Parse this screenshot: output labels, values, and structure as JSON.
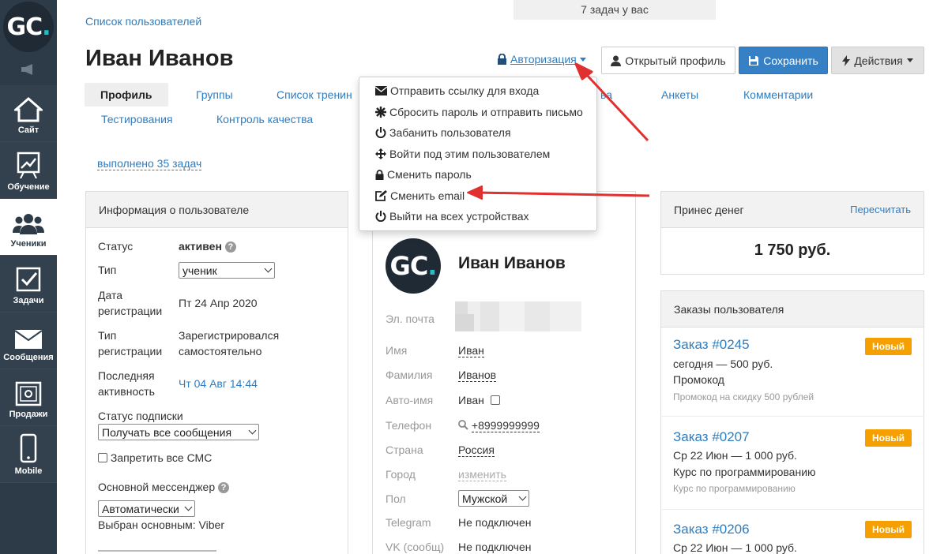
{
  "top_notice": "7 задач у вас",
  "breadcrumb": "Список пользователей",
  "page_title": "Иван Иванов",
  "header": {
    "auth_label": "Авторизация",
    "open_profile": "Открытый профиль",
    "save": "Сохранить",
    "actions": "Действия"
  },
  "sidebar": {
    "items": [
      {
        "label": "Сайт",
        "icon": "house-icon"
      },
      {
        "label": "Обучение",
        "icon": "chart-board-icon"
      },
      {
        "label": "Ученики",
        "icon": "users-icon"
      },
      {
        "label": "Задачи",
        "icon": "checkbox-icon"
      },
      {
        "label": "Сообщения",
        "icon": "envelope-icon"
      },
      {
        "label": "Продажи",
        "icon": "safe-icon"
      },
      {
        "label": "Mobile",
        "icon": "mobile-icon"
      }
    ]
  },
  "tabs": {
    "profile": "Профиль",
    "groups": "Группы",
    "trainings": "Список тренин",
    "rights_tail": "ва",
    "forms": "Анкеты",
    "comments": "Комментарии",
    "tests": "Тестирования",
    "quality": "Контроль качества"
  },
  "done_tasks": "выполнено 35 задач",
  "dropdown": {
    "items": [
      {
        "label": "Отправить ссылку для входа",
        "icon": "envelope-icon"
      },
      {
        "label": "Сбросить пароль и отправить письмо",
        "icon": "asterisk-icon"
      },
      {
        "label": "Забанить пользователя",
        "icon": "power-icon"
      },
      {
        "label": "Войти под этим пользователем",
        "icon": "move-icon"
      },
      {
        "label": "Сменить пароль",
        "icon": "lock-icon"
      },
      {
        "label": "Сменить email",
        "icon": "edit-icon"
      },
      {
        "label": "Выйти на всех устройствах",
        "icon": "power-icon"
      }
    ]
  },
  "info": {
    "title": "Информация о пользователе",
    "status_label": "Статус",
    "status_value": "активен",
    "type_label": "Тип",
    "type_value": "ученик",
    "reg_date_label_1": "Дата",
    "reg_date_label_2": "регистрации",
    "reg_date_value": "Пт 24 Апр 2020",
    "reg_type_label_1": "Тип",
    "reg_type_label_2": "регистрации",
    "reg_type_value_1": "Зарегистрировался",
    "reg_type_value_2": "самостоятельно",
    "last_label_1": "Последняя",
    "last_label_2": "активность",
    "last_value": "Чт 04 Авг 14:44",
    "sub_label": "Статус подписки",
    "sub_value": "Получать все сообщения",
    "sms_label": "Запретить все СМС",
    "messenger_label": "Основной мессенджер",
    "messenger_value": "Автоматически",
    "messenger_note": "Выбран основным: Viber"
  },
  "profile": {
    "name": "Иван Иванов",
    "email_label": "Эл. почта",
    "first_name_label": "Имя",
    "first_name": "Иван",
    "last_name_label": "Фамилия",
    "last_name": "Иванов",
    "autoname_label": "Авто-имя",
    "autoname": "Иван",
    "phone_label": "Телефон",
    "phone": "+8999999999",
    "country_label": "Страна",
    "country": "Россия",
    "city_label": "Город",
    "city": "изменить",
    "gender_label": "Пол",
    "gender": "Мужской",
    "telegram_label": "Telegram",
    "telegram": "Не подключен",
    "vk_label": "VK (сообщ)",
    "vk": "Не подключен"
  },
  "money": {
    "title": "Принес денег",
    "recalc": "Пересчитать",
    "amount": "1 750 руб."
  },
  "orders": {
    "title": "Заказы пользователя",
    "list": [
      {
        "id": "Заказ #0245",
        "badge": "Новый",
        "line1": "сегодня — 500 руб.",
        "line2": "Промокод",
        "note": "Промокод на скидку 500 рублей"
      },
      {
        "id": "Заказ #0207",
        "badge": "Новый",
        "line1": "Ср 22 Июн — 1 000 руб.",
        "line2": "Курс по программированию",
        "note": "Курс по программированию"
      },
      {
        "id": "Заказ #0206",
        "badge": "Новый",
        "line1": "Ср 22 Июн — 1 000 руб."
      }
    ]
  },
  "colors": {
    "sidebar": "#2d3a47",
    "accent": "#2e7dc0",
    "save": "#3681c6",
    "badge": "#f5a000",
    "arrow": "#e03030"
  }
}
